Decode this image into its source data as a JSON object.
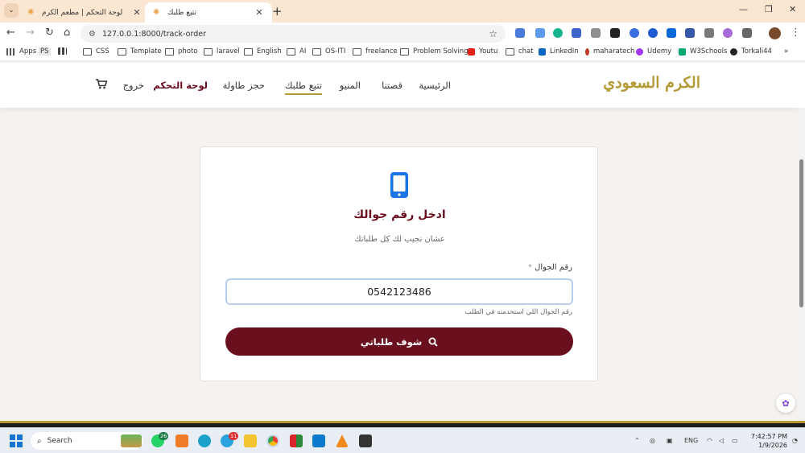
{
  "browser": {
    "tabs": [
      {
        "title": "لوحة التحكم | مطعم الكرم",
        "active": false
      },
      {
        "title": "تتبع طلبك",
        "active": true
      }
    ],
    "url": "127.0.0.1:8000/track-order",
    "bookmarks": [
      "Apps",
      "PS",
      "CSS",
      "Template",
      "photo",
      "laravel",
      "English",
      "AI",
      "OS-ITI",
      "freelance",
      "Problem Solving",
      "Youtu",
      "chat",
      "LinkedIn",
      "maharatech",
      "Udemy",
      "W3Schools",
      "Torkali44"
    ]
  },
  "site": {
    "logo": "الكرم السعودي",
    "nav": {
      "home": "الرئيسية",
      "story": "قصتنا",
      "menu": "المنيو",
      "track": "تتبع طلبك",
      "reserve": "حجز طاولة",
      "dashboard": "لوحة التحكم",
      "logout": "خروج"
    }
  },
  "track_form": {
    "title": "ادخل رقم جوالك",
    "subtitle": "عشان نجيب لك كل طلباتك",
    "phone_label": "رقم الجوال",
    "required_mark": "*",
    "phone_value": "0542123486",
    "hint": "رقم الجوال اللي استخدمته في الطلب",
    "submit_label": "شوف طلباتي"
  },
  "taskbar": {
    "search_placeholder": "Search",
    "whatsapp_badge": "26",
    "telegram_badge": "11",
    "language": "ENG",
    "time": "7:42:57 PM",
    "date": "1/9/2026"
  },
  "colors": {
    "brand_maroon": "#6a0f1e",
    "brand_gold": "#b39a35",
    "icon_blue": "#1a73e8"
  }
}
